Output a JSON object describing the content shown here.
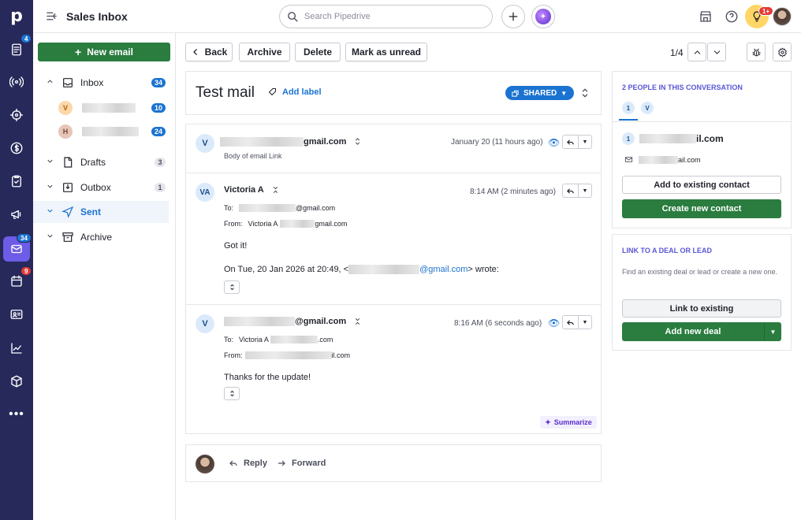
{
  "rail": {
    "logo": "p",
    "badges": {
      "deals": "4",
      "mail": "34",
      "activities": "9"
    }
  },
  "topbar": {
    "title": "Sales Inbox",
    "search_placeholder": "Search Pipedrive",
    "tips_badge": "1+"
  },
  "sidebar": {
    "new_email": "New email",
    "inbox": {
      "label": "Inbox",
      "count": "34"
    },
    "accounts": [
      {
        "initial": "V",
        "count": "10"
      },
      {
        "initial": "H",
        "count": "24"
      }
    ],
    "drafts": {
      "label": "Drafts",
      "count": "3"
    },
    "outbox": {
      "label": "Outbox",
      "count": "1"
    },
    "sent": {
      "label": "Sent"
    },
    "archive": {
      "label": "Archive"
    }
  },
  "toolbar": {
    "back": "Back",
    "archive": "Archive",
    "delete": "Delete",
    "mark_unread": "Mark as unread",
    "pager": "1/4"
  },
  "thread": {
    "subject": "Test mail",
    "add_label": "Add label",
    "shared": "SHARED",
    "messages": [
      {
        "initials": "V",
        "sender_suffix": "gmail.com",
        "time": "January 20 (11 hours ago)",
        "preview": "Body of email Link"
      },
      {
        "initials": "VA",
        "sender": "Victoria A",
        "time": "8:14 AM (2 minutes ago)",
        "to_label": "To:",
        "to_suffix": "@gmail.com",
        "from_label": "From:",
        "from_name": "Victoria A",
        "from_suffix": "gmail.com",
        "body": "Got it!",
        "quote_prefix": "On Tue, 20 Jan 2026 at 20:49, <",
        "quote_email": "@gmail.com",
        "quote_suffix": "> wrote:"
      },
      {
        "initials": "V",
        "sender_suffix": "@gmail.com",
        "time": "8:16 AM (6 seconds ago)",
        "to_label": "To:",
        "to_name": "Victoria A",
        "to_suffix": ".com",
        "from_label": "From:",
        "from_suffix": "il.com",
        "body": "Thanks for the update!"
      }
    ],
    "summarize": "Summarize",
    "reply": "Reply",
    "forward": "Forward"
  },
  "right": {
    "people_heading": "2 PEOPLE IN THIS CONVERSATION",
    "tabs": [
      "1",
      "V"
    ],
    "person_index": "1",
    "person_suffix": "il.com",
    "person_email_suffix": "ail.com",
    "add_existing": "Add to existing contact",
    "create_new": "Create new contact",
    "link_heading": "LINK TO A DEAL OR LEAD",
    "link_desc": "Find an existing deal or lead or create a new one.",
    "link_existing": "Link to existing",
    "add_deal": "Add new deal"
  },
  "colors": {
    "rail": "#26295a",
    "green": "#2a7d3f",
    "blue": "#1b73d1",
    "purple_heading": "#5956d6"
  }
}
